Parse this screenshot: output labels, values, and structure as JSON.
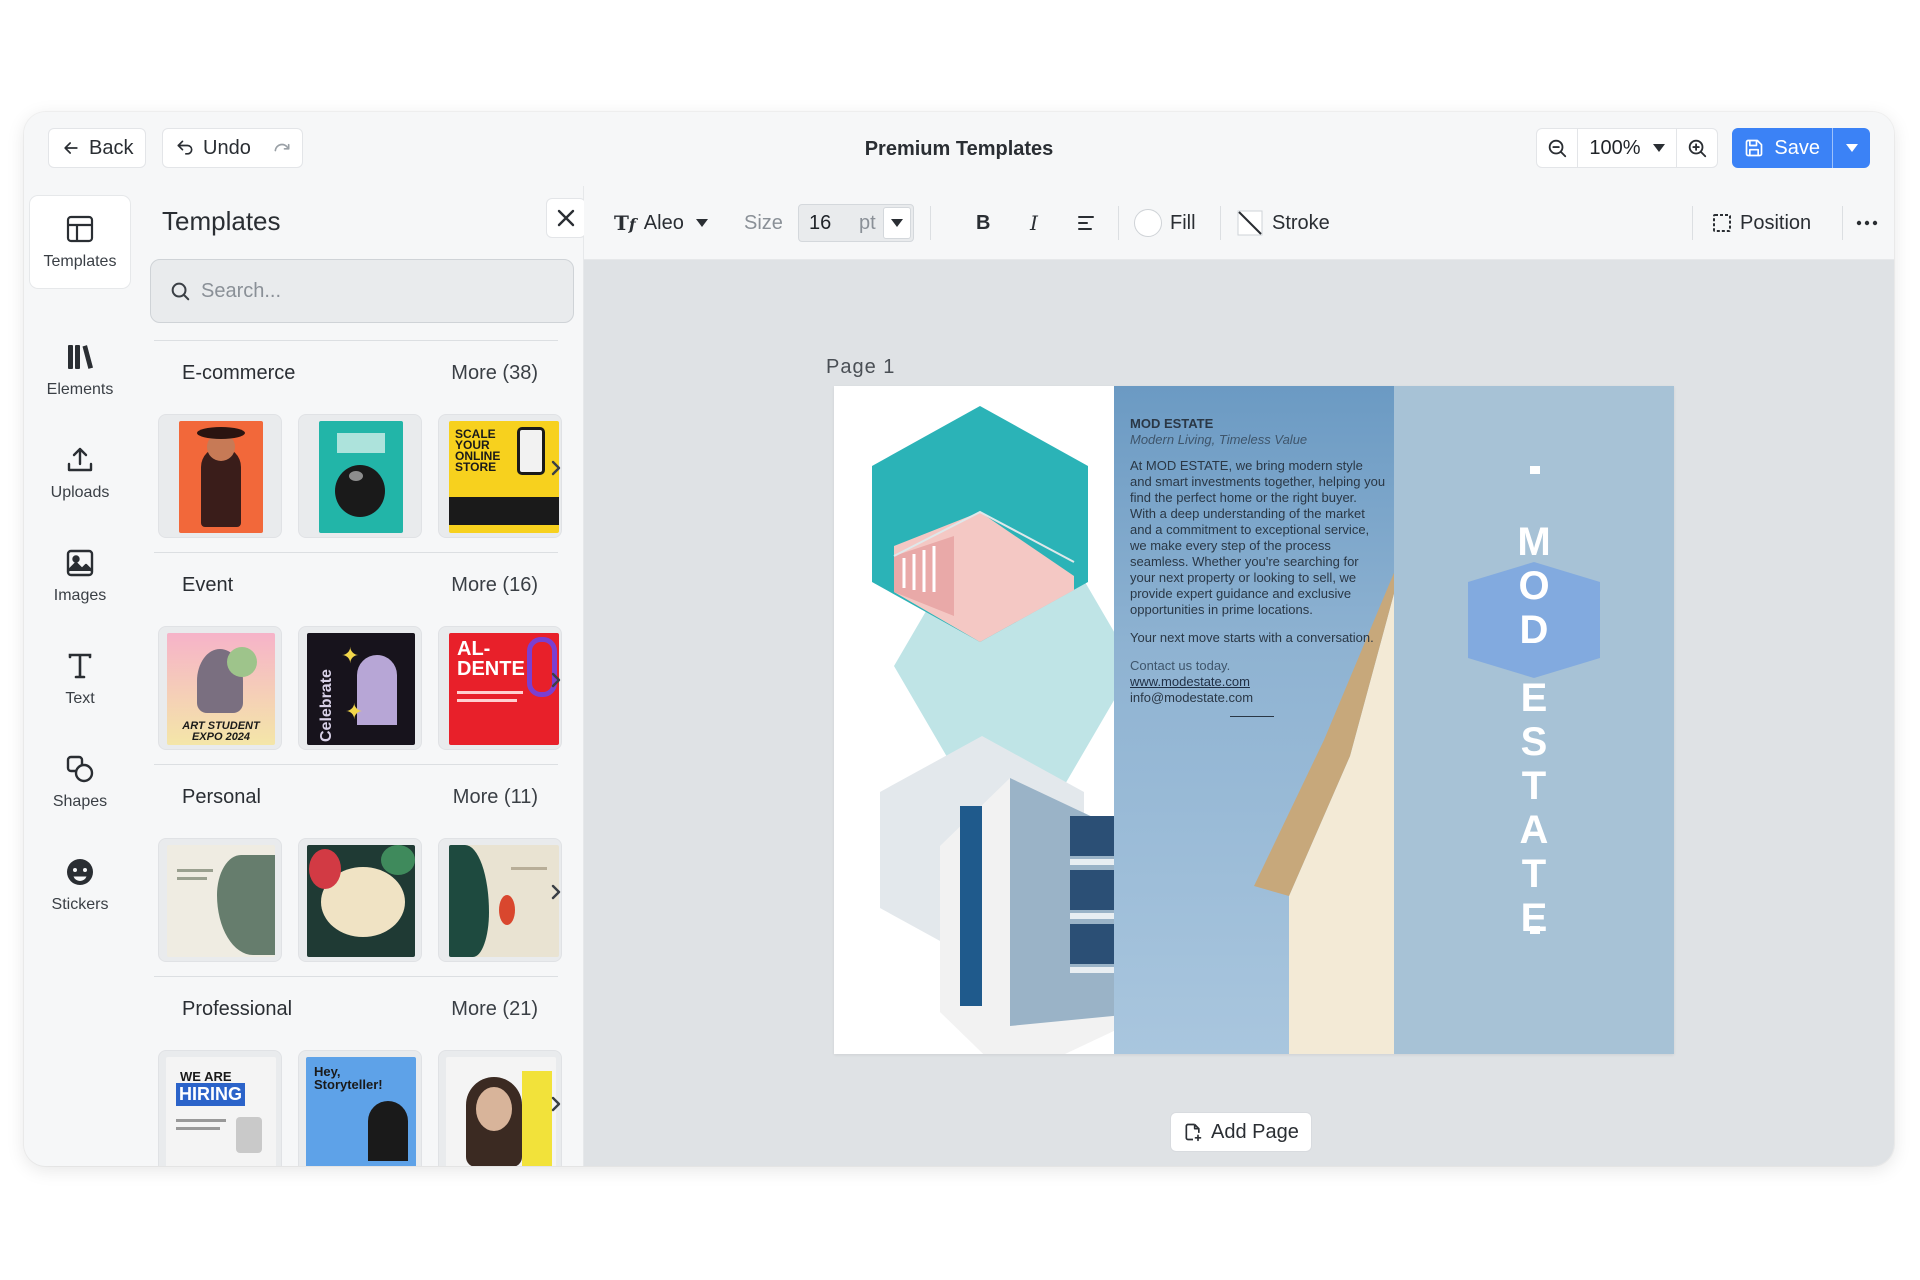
{
  "topbar": {
    "back_label": "Back",
    "undo_label": "Undo",
    "title": "Premium Templates",
    "zoom": "100%",
    "save_label": "Save"
  },
  "rail": {
    "items": [
      {
        "label": "Templates",
        "icon": "layout-icon"
      },
      {
        "label": "Elements",
        "icon": "library-icon"
      },
      {
        "label": "Uploads",
        "icon": "upload-icon"
      },
      {
        "label": "Images",
        "icon": "image-icon"
      },
      {
        "label": "Text",
        "icon": "text-icon"
      },
      {
        "label": "Shapes",
        "icon": "shapes-icon"
      },
      {
        "label": "Stickers",
        "icon": "sticker-icon"
      }
    ]
  },
  "panel": {
    "title": "Templates",
    "search_placeholder": "Search...",
    "sections": [
      {
        "name": "E-commerce",
        "more": "More (38)"
      },
      {
        "name": "Event",
        "more": "More (16)"
      },
      {
        "name": "Personal",
        "more": "More (11)"
      },
      {
        "name": "Professional",
        "more": "More (21)"
      }
    ],
    "thumb_text": {
      "ec3": "SCALE YOUR ONLINE STORE",
      "ev1": "ART STUDENT EXPO 2024",
      "ev2": "Celebrate",
      "ev3": "AL- DENTE",
      "pr1a": "WE ARE",
      "pr1b": "HIRING",
      "pr2": "Hey, Storyteller!"
    }
  },
  "toolbar": {
    "font": "Aleo",
    "size_label": "Size",
    "size_value": "16",
    "size_unit": "pt",
    "bold": "B",
    "italic": "I",
    "fill_label": "Fill",
    "stroke_label": "Stroke",
    "position_label": "Position"
  },
  "canvas": {
    "page_label": "Page  1",
    "add_page_label": "Add Page"
  },
  "document": {
    "brand": "MOD ESTATE",
    "tagline": "Modern Living, Timeless Value",
    "body1": "At MOD ESTATE, we bring modern style and smart investments together, helping you find the perfect home or the right buyer. With a deep understanding of the market and a commitment to exceptional service, we make every step of the process seamless. Whether you're searching for your next property or looking to sell, we provide expert guidance and exclusive opportunities in prime locations.",
    "body2": "Your next move starts with a conversation.",
    "contact_intro": "Contact us today.",
    "website": "www.modestate.com",
    "email": "info@modestate.com",
    "vertical_word1": "MOD",
    "vertical_word2": "ESTATE"
  },
  "colors": {
    "accent": "#3b82f6",
    "hex_teal": "#2bb3b7",
    "panel_blue": "#a7c2d6"
  }
}
